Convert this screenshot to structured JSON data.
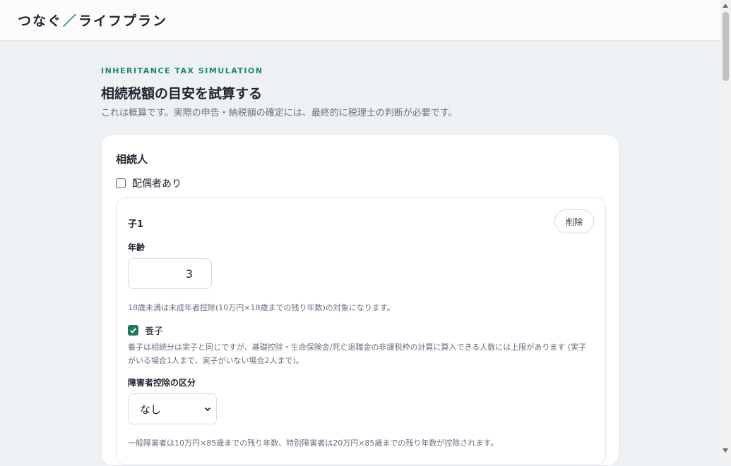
{
  "header": {
    "brand_left": "つなぐ",
    "brand_slash": "／",
    "brand_right": "ライフプラン"
  },
  "intro": {
    "eyebrow": "INHERITANCE TAX SIMULATION",
    "title": "相続税額の目安を試算する",
    "lead": "これは概算です。実際の申告・納税額の確定には、最終的に税理士の判断が必要です。"
  },
  "heirs": {
    "section_title": "相続人",
    "spouse_label": "配偶者あり",
    "spouse_checked": false,
    "child": {
      "title": "子1",
      "delete_label": "削除",
      "age_label": "年齢",
      "age_value": "3",
      "age_hint": "18歳未満は未成年者控除(10万円×18歳までの残り年数)の対象になります。",
      "adopted_label": "養子",
      "adopted_checked": true,
      "adopted_hint": "養子は相続分は実子と同じですが、基礎控除・生命保険金/死亡退職金の非課税枠の計算に算入できる人数には上限があります (実子がいる場合1人まで、実子がいない場合2人まで)。",
      "disability_label": "障害者控除の区分",
      "disability_value": "なし",
      "disability_hint": "一般障害者は10万円×85歳までの残り年数、特別障害者は20万円×85歳までの残り年数が控除されます。"
    }
  },
  "colors": {
    "accent": "#1f8a6a",
    "checkbox_checked": "#1f7a5c"
  }
}
